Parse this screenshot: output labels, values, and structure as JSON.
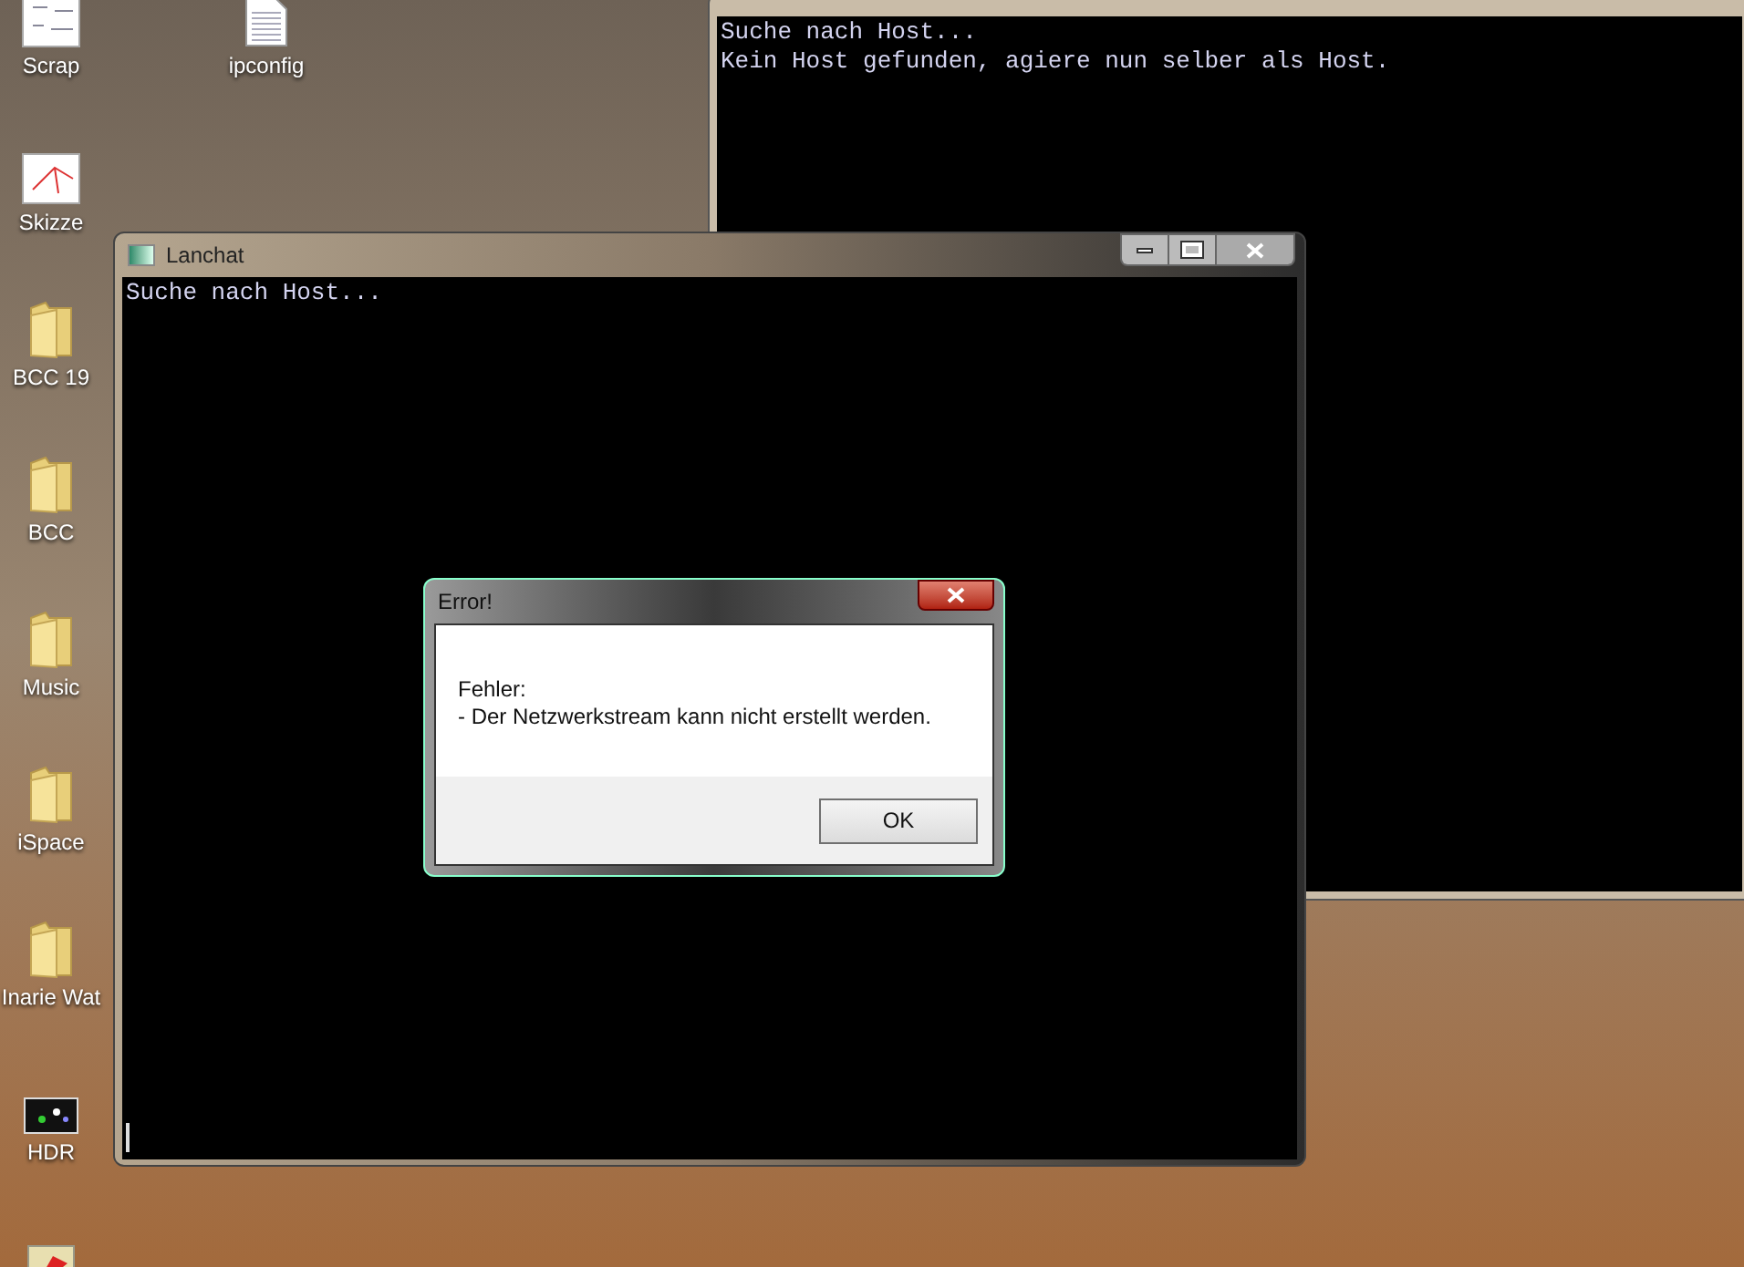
{
  "desktop_icons": [
    {
      "label": "Scrap",
      "kind": "thumbnail"
    },
    {
      "label": "ipconfig",
      "kind": "textfile"
    },
    {
      "label": "Skizze",
      "kind": "sketch"
    },
    {
      "label": "BCC 19",
      "kind": "folder"
    },
    {
      "label": "BCC",
      "kind": "folder"
    },
    {
      "label": "Music",
      "kind": "folder"
    },
    {
      "label": "iSpace",
      "kind": "folder"
    },
    {
      "label": "Inarie Wat",
      "kind": "folder"
    },
    {
      "label": "HDR",
      "kind": "image"
    },
    {
      "kind": "app"
    }
  ],
  "host_window": {
    "console_lines": [
      "Suche nach Host...",
      "Kein Host gefunden, agiere nun selber als Host."
    ]
  },
  "chat_window": {
    "title": "Lanchat",
    "console_lines": [
      "Suche nach Host..."
    ]
  },
  "error_dialog": {
    "title": "Error!",
    "message_lines": [
      "Fehler:",
      "- Der Netzwerkstream kann nicht erstellt werden."
    ],
    "buttons": [
      "OK"
    ]
  }
}
